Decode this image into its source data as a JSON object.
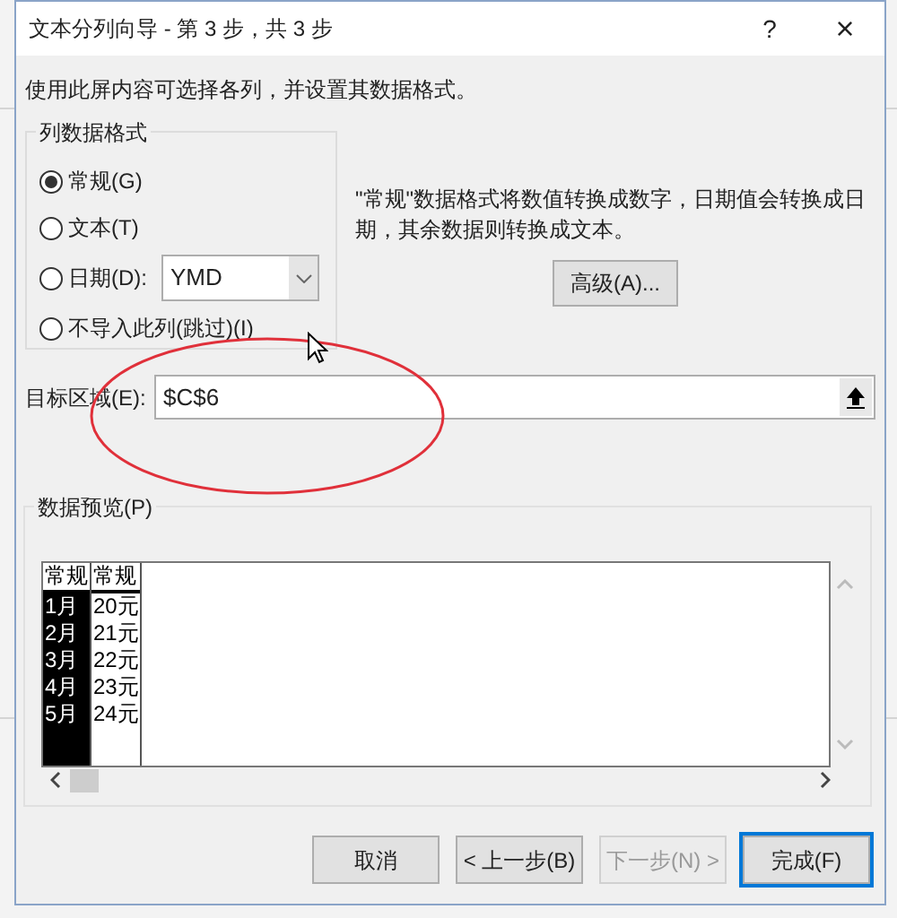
{
  "window": {
    "title": "文本分列向导 - 第 3 步，共 3 步",
    "help": "?",
    "close": "×"
  },
  "instruction": "使用此屏内容可选择各列，并设置其数据格式。",
  "format_group": {
    "title": "列数据格式",
    "options": [
      {
        "label": "常规(G)",
        "selected": true
      },
      {
        "label": "文本(T)",
        "selected": false
      },
      {
        "label": "日期(D):",
        "selected": false
      },
      {
        "label": "不导入此列(跳过)(I)",
        "selected": false
      }
    ],
    "date_format": {
      "value": "YMD"
    }
  },
  "description": "\"常规\"数据格式将数值转换成数字，日期值会转换成日期，其余数据则转换成文本。",
  "advanced_button": "高级(A)...",
  "destination": {
    "label": "目标区域(E):",
    "value": "$C$6"
  },
  "preview": {
    "title": "数据预览(P)",
    "columns": [
      {
        "header": "常规",
        "selected": true,
        "cells": [
          "1月",
          "2月",
          "3月",
          "4月",
          "5月"
        ]
      },
      {
        "header": "常规",
        "selected": false,
        "cells": [
          "20元",
          "21元",
          "22元",
          "23元",
          "24元"
        ]
      }
    ]
  },
  "buttons": [
    {
      "label": "取消",
      "disabled": false,
      "focused": false
    },
    {
      "label": "< 上一步(B)",
      "disabled": false,
      "focused": false
    },
    {
      "label": "下一步(N) >",
      "disabled": true,
      "focused": false
    },
    {
      "label": "完成(F)",
      "disabled": false,
      "focused": true
    }
  ]
}
